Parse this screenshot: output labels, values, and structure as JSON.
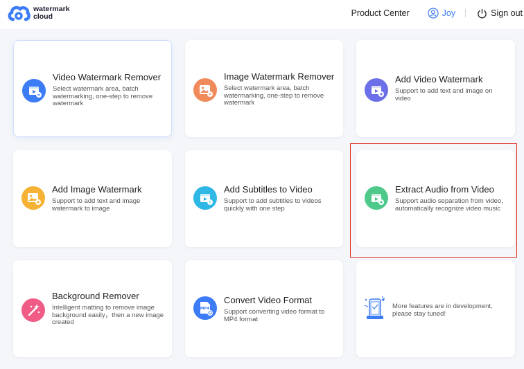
{
  "header": {
    "logo_line1": "watermark",
    "logo_line2": "cloud",
    "product_center": "Product Center",
    "user_name": "Joy",
    "sign_out": "Sign out"
  },
  "colors": {
    "accent": "#3c7cf6",
    "highlight": "#e0291f"
  },
  "cards": [
    {
      "title": "Video Watermark Remover",
      "desc": "Select watermark area, batch watermarking, one-step to remove watermark",
      "icon": "video-icon",
      "color": "#3c7cf6"
    },
    {
      "title": "Image Watermark Remover",
      "desc": "Select watermark area, batch watermarking, one-step to remove watermark",
      "icon": "image-icon",
      "color": "#f08a5a"
    },
    {
      "title": "Add Video Watermark",
      "desc": "Support to add text and image on video",
      "icon": "video-icon",
      "color": "#6b6fe8"
    },
    {
      "title": "Add Image Watermark",
      "desc": "Support to add text and image watermark to image",
      "icon": "image-icon",
      "color": "#f5b234"
    },
    {
      "title": "Add Subtitles to Video",
      "desc": "Support to add subtitles to videos quickly with one step",
      "icon": "video-icon",
      "color": "#2fb7e6"
    },
    {
      "title": "Extract Audio from Video",
      "desc": "Support audio separation from video, automatically recognize video music",
      "icon": "video-icon",
      "color": "#4fc98a"
    },
    {
      "title": "Background Remover",
      "desc": "Intelligent matting to remove image background easily，then a new image created",
      "icon": "magic-wand-icon",
      "color": "#f05c86"
    },
    {
      "title": "Convert Video Format",
      "desc": "Support converting video format to MP4 format",
      "icon": "mp4-file-icon",
      "color": "#3c7cf6",
      "badge": "MP4"
    }
  ],
  "dev_notice": "More features are in development, please stay tuned!"
}
